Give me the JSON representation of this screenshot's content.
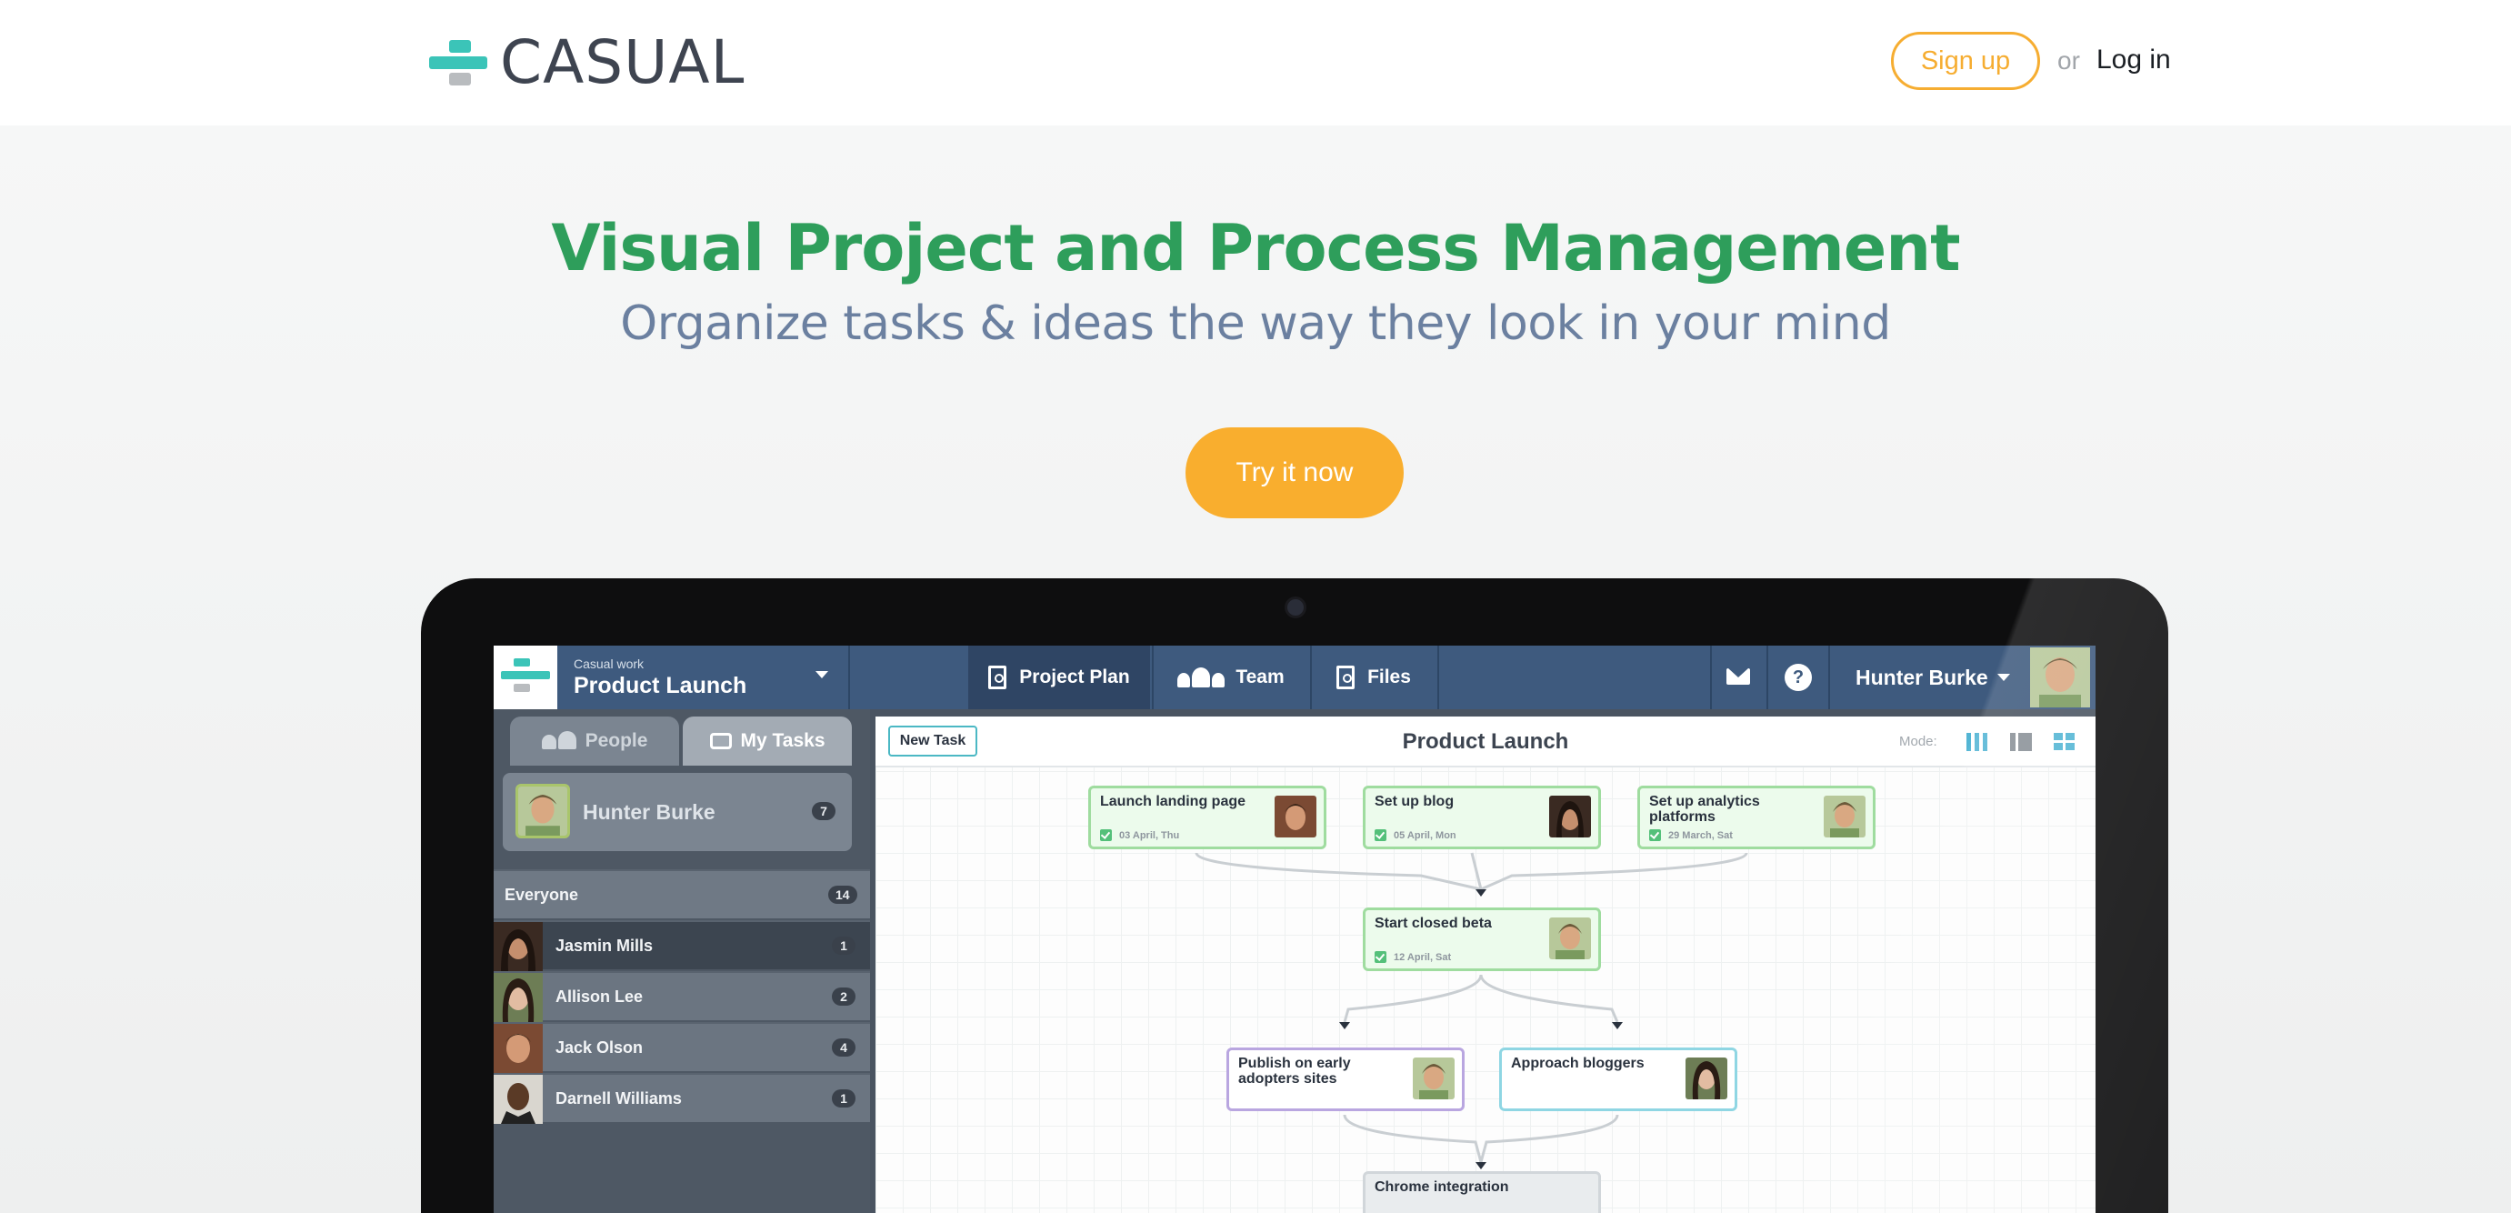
{
  "header": {
    "logo_text": "CASUAL",
    "signup_label": "Sign up",
    "or_text": "or",
    "login_label": "Log in"
  },
  "hero": {
    "title": "Visual Project and Process Management",
    "subtitle": "Organize tasks & ideas the way they look in your mind",
    "cta_label": "Try it now"
  },
  "app": {
    "workspace_small": "Casual work",
    "workspace_name": "Product Launch",
    "tabs": [
      {
        "label": "Project Plan",
        "icon": "document-icon"
      },
      {
        "label": "Team",
        "icon": "people-icon"
      },
      {
        "label": "Files",
        "icon": "files-icon"
      }
    ],
    "help_glyph": "?",
    "user_name": "Hunter Burke",
    "sidebar": {
      "tab_people": "People",
      "tab_mytasks": "My Tasks",
      "me": {
        "name": "Hunter Burke",
        "count": "7"
      },
      "everyone": {
        "label": "Everyone",
        "count": "14"
      },
      "members": [
        {
          "name": "Jasmin Mills",
          "count": "1"
        },
        {
          "name": "Allison Lee",
          "count": "2"
        },
        {
          "name": "Jack Olson",
          "count": "4"
        },
        {
          "name": "Darnell Williams",
          "count": "1"
        }
      ]
    },
    "canvas": {
      "new_task_label": "New Task",
      "title": "Product Launch",
      "mode_label": "Mode:",
      "tasks": [
        {
          "title": "Launch landing page",
          "date": "03 April, Thu"
        },
        {
          "title": "Set up blog",
          "date": "05 April, Mon"
        },
        {
          "title": "Set up analytics platforms",
          "date": "29 March, Sat"
        },
        {
          "title": "Start closed beta",
          "date": "12 April, Sat"
        },
        {
          "title": "Publish on early adopters sites",
          "date": ""
        },
        {
          "title": "Approach bloggers",
          "date": ""
        },
        {
          "title": "Chrome integration",
          "date": ""
        }
      ]
    }
  },
  "colors": {
    "brand_teal": "#3bc4b8",
    "hero_green": "#2e9e5b",
    "accent_orange": "#f9ae2e",
    "app_bar_blue": "#3e5a7e"
  }
}
